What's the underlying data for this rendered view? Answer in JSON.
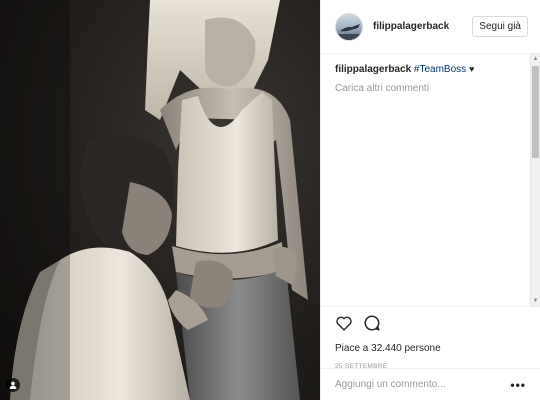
{
  "post": {
    "username": "filippalagerback",
    "follow_label": "Segui già",
    "caption": {
      "user": "filippalagerback",
      "hashtag": "#TeamBoss",
      "emoji": "♥"
    },
    "load_more_label": "Carica altri commenti",
    "likes_text": "Piace a 32.440 persone",
    "date": "25 SETTEMBRE",
    "comment_placeholder": "Aggiungi un commento...",
    "more_label": "•••"
  },
  "icons": {
    "like": "heart-icon",
    "comment": "comment-icon",
    "tag": "user-tag-icon",
    "avatar": "avatar-icon",
    "more": "more-options-icon"
  }
}
